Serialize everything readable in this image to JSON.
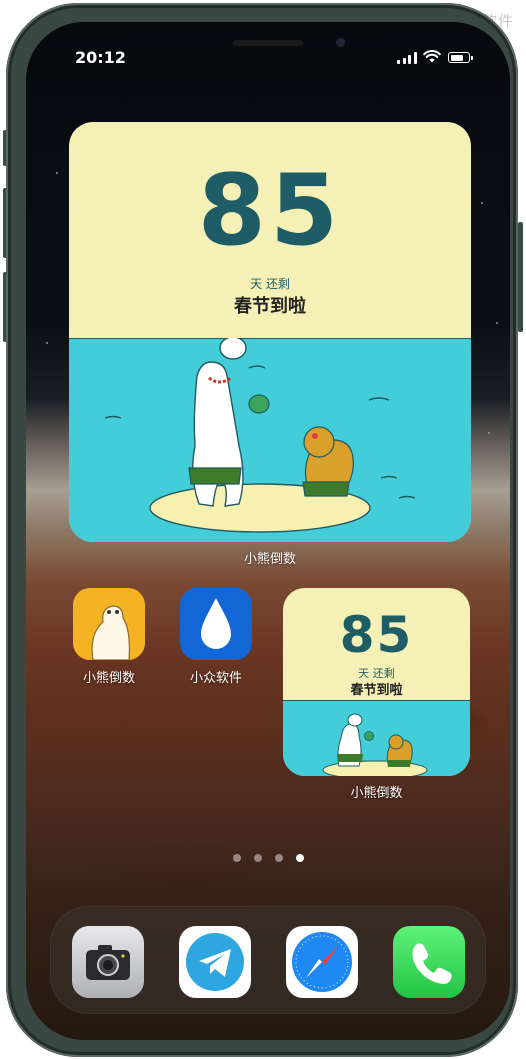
{
  "watermark": "小众软件",
  "status_bar": {
    "time": "20:12",
    "icons": [
      "signal-icon",
      "wifi-icon",
      "battery-icon"
    ]
  },
  "large_widget": {
    "count": "85",
    "unit": "天 还剩",
    "event": "春节到啦",
    "label": "小熊倒数"
  },
  "apps": [
    {
      "label": "小熊倒数",
      "icon": "polar-bear-icon"
    },
    {
      "label": "小众软件",
      "icon": "water-drop-icon"
    }
  ],
  "small_widget": {
    "count": "85",
    "unit": "天 还剩",
    "event": "春节到啦",
    "label": "小熊倒数"
  },
  "page_indicator": {
    "pages": 4,
    "active_page": 4
  },
  "dock": [
    {
      "icon": "camera-icon"
    },
    {
      "icon": "telegram-icon"
    },
    {
      "icon": "safari-icon"
    },
    {
      "icon": "phone-icon"
    }
  ],
  "colors": {
    "widget_background": "#f5f1b6",
    "widget_sea": "#43cdd9",
    "count_text": "#1f5d66",
    "bear_app_background": "#f5b324",
    "drop_app_background": "#1366d6",
    "phone_green": "#34c759"
  }
}
